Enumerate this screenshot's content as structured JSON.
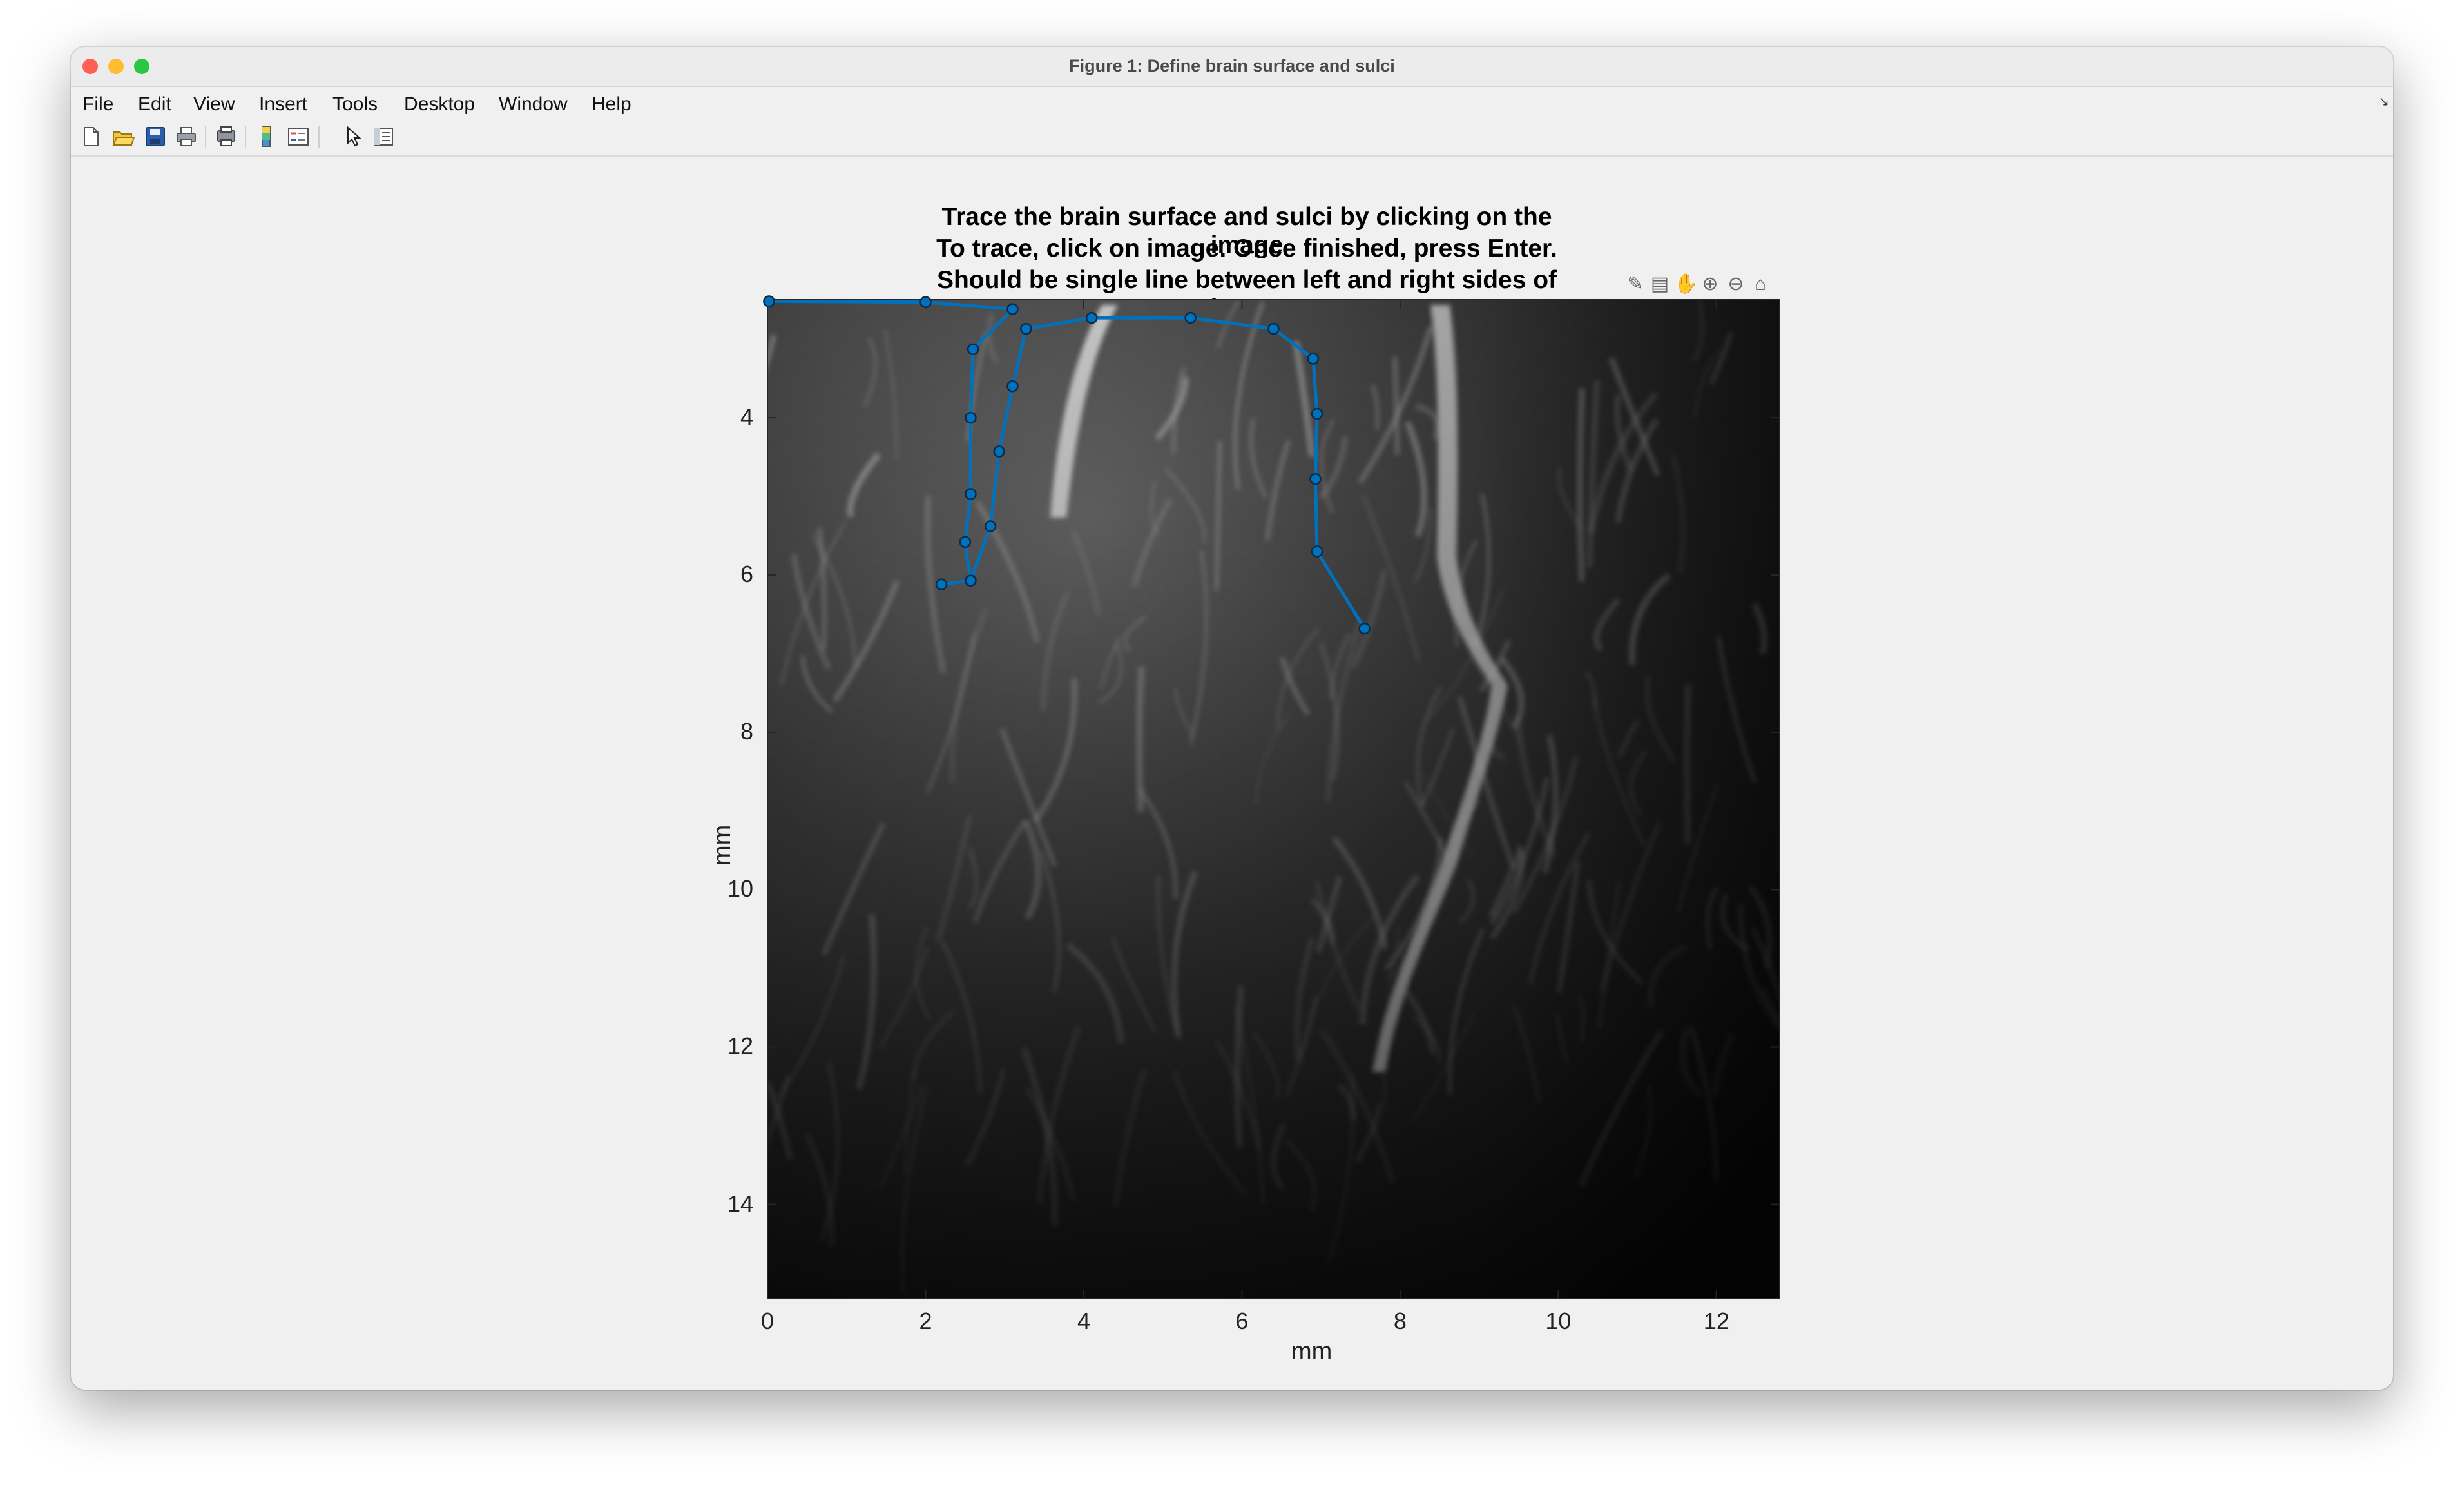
{
  "window": {
    "title": "Figure 1: Define brain surface and sulci"
  },
  "menu": {
    "items": [
      "File",
      "Edit",
      "View",
      "Insert",
      "Tools",
      "Desktop",
      "Window",
      "Help"
    ],
    "collapse_icon": "arrow-icon"
  },
  "toolbar": {
    "buttons": [
      "new-figure-icon",
      "open-icon",
      "save-icon",
      "print-icon",
      "print-preview-icon",
      "colorbar-icon",
      "legend-icon",
      "pointer-icon",
      "property-editor-icon"
    ]
  },
  "axes_toolbar": {
    "buttons": [
      "brush-icon",
      "datatip-icon",
      "pan-icon",
      "zoom-in-icon",
      "zoom-out-icon",
      "home-icon"
    ]
  },
  "plot": {
    "title_lines": [
      "Trace the brain surface and sulci by clicking on the image",
      "To trace, click on image. Once finished, press Enter.",
      "Should be single line between left and right sides of image"
    ],
    "xlabel": "mm",
    "ylabel": "mm",
    "xticks": [
      "0",
      "2",
      "4",
      "6",
      "8",
      "10",
      "12"
    ],
    "yticks": [
      "4",
      "6",
      "8",
      "10",
      "12",
      "14"
    ],
    "line_color": "#0072bd"
  },
  "chart_data": {
    "type": "line",
    "title": "Trace the brain surface and sulci by clicking on the image / To trace, click on image. Once finished, press Enter. / Should be single line between left and right sides of image",
    "xlabel": "mm",
    "ylabel": "mm",
    "xlim": [
      0,
      12.8
    ],
    "ylim": [
      2.5,
      15.2
    ],
    "y_reversed": true,
    "grid": false,
    "series": [
      {
        "x": [
          0.02,
          2.0,
          3.1,
          2.6,
          2.57,
          2.57,
          2.5,
          2.57,
          2.2,
          2.57,
          2.82,
          2.93,
          3.1,
          3.27,
          4.1,
          5.35,
          6.4,
          6.9,
          6.95,
          6.93,
          6.95,
          7.55
        ],
        "y": [
          2.52,
          2.53,
          2.62,
          3.13,
          4.0,
          4.97,
          5.58,
          6.07,
          6.12,
          6.07,
          5.38,
          4.43,
          3.6,
          2.87,
          2.73,
          2.73,
          2.87,
          3.25,
          3.95,
          4.78,
          5.7,
          6.68
        ]
      }
    ]
  }
}
